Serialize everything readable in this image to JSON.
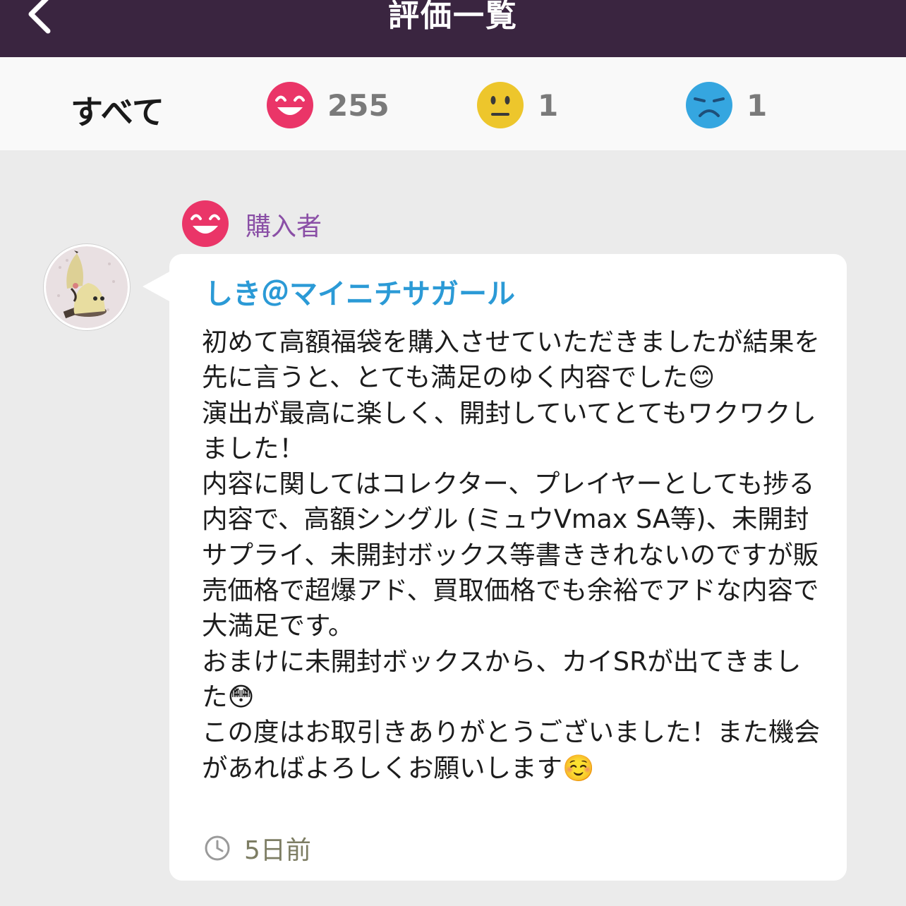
{
  "header": {
    "title": "評価一覧",
    "back_icon": "chevron-left-icon"
  },
  "filters": {
    "all_label": "すべて",
    "good": {
      "icon": "happy-face-icon",
      "count": "255",
      "color": "#ea3568"
    },
    "normal": {
      "icon": "neutral-face-icon",
      "count": "1",
      "color": "#edc62c"
    },
    "bad": {
      "icon": "sad-face-icon",
      "count": "1",
      "color": "#35a6e0"
    }
  },
  "review": {
    "rating_icon": "happy-face-icon",
    "role": "購入者",
    "avatar_icon": "user-avatar",
    "username": "しき＠マイニチサガール",
    "comment": "初めて高額福袋を購入させていただきましたが結果を先に言うと、とても満足のゆく内容でした😊\n演出が最高に楽しく、開封していてとてもワクワクしました！\n内容に関してはコレクター、プレイヤーとしても捗る内容で、高額シングル (ミュウVmax SA等)、未開封サプライ、未開封ボックス等書ききれないのですが販売価格で超爆アド、買取価格でも余裕でアドな内容で大満足です。\nおまけに未開封ボックスから、カイSRが出てきました😳\nこの度はお取引きありがとうございました！また機会があればよろしくお願いします☺️",
    "time_icon": "clock-icon",
    "time": "5日前"
  }
}
